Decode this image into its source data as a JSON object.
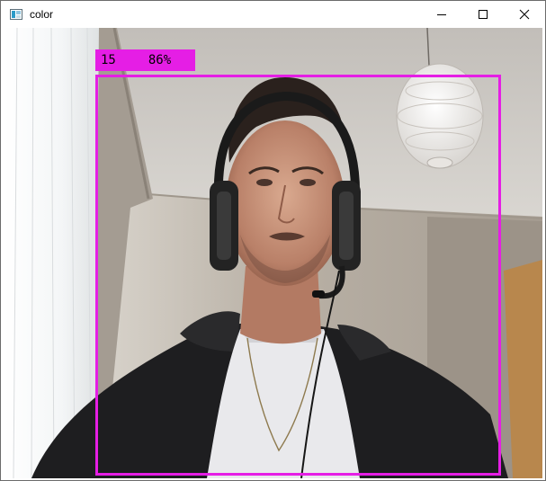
{
  "window": {
    "title": "color",
    "icon": "image-window-icon",
    "controls": {
      "minimize": "minimize-icon",
      "maximize": "maximize-icon",
      "close": "close-icon"
    }
  },
  "detection": {
    "id": "15",
    "confidence": "86%",
    "color": "#e51ee5"
  }
}
